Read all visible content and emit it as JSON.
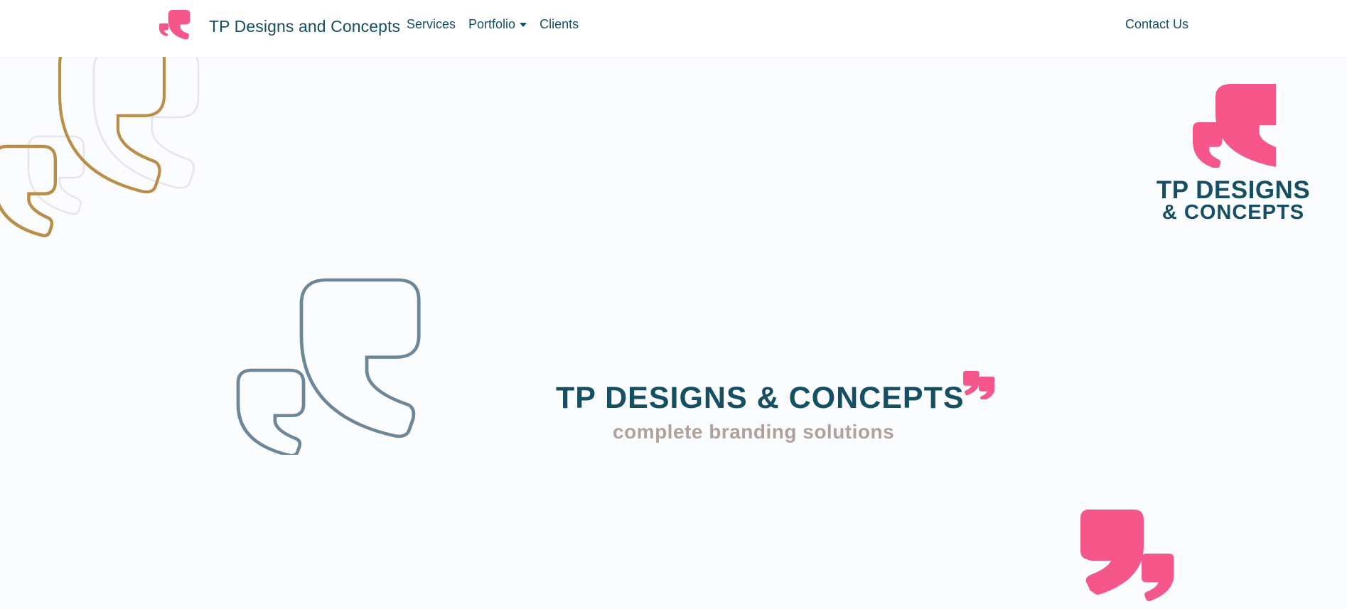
{
  "nav": {
    "brand_text": "TP Designs and Concepts",
    "links": [
      {
        "label": "Services"
      },
      {
        "label": "Portfolio"
      },
      {
        "label": "Clients"
      }
    ],
    "contact_label": "Contact Us"
  },
  "hero": {
    "title": "TP DESIGNS & CONCEPTS",
    "tagline": "complete branding solutions",
    "corner_logo": {
      "line1": "TP DESIGNS",
      "line2": "& CONCEPTS"
    }
  },
  "icons": {
    "brand": "quote-marks-icon",
    "nav_caret": "chevron-down-icon",
    "title_accent": "comma-quote-icon"
  },
  "colors": {
    "brand_pink": "#f5578a",
    "brand_teal": "#154f63",
    "gold_outline": "#b98e48",
    "slate_outline": "#6d8798",
    "tagline_taupe": "#b1a19b",
    "ghost_outline": "#e6e6ea"
  }
}
